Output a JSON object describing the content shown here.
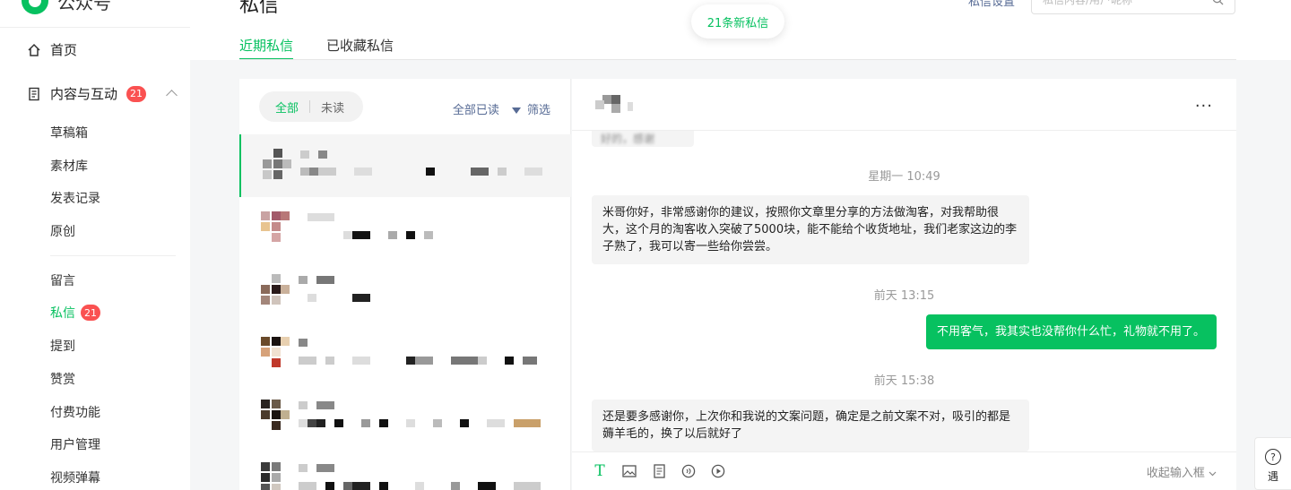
{
  "brand": {
    "name": "公众号"
  },
  "sidebar": {
    "home_label": "首页",
    "content_label": "内容与互动",
    "content_badge": "21",
    "group1": [
      "草稿箱",
      "素材库",
      "发表记录",
      "原创"
    ],
    "group2": [
      "留言",
      "私信",
      "提到",
      "赞赏",
      "付费功能",
      "用户管理",
      "视频弹幕"
    ],
    "messages_badge": "21"
  },
  "header": {
    "title": "私信",
    "settings": "私信设置",
    "search_placeholder": "私信内容/用户昵称",
    "toast": "21条新私信",
    "tabs": [
      "近期私信",
      "已收藏私信"
    ]
  },
  "list": {
    "filter_all": "全部",
    "filter_unread": "未读",
    "mark_all_read": "全部已读",
    "filter_label": "筛选"
  },
  "chat": {
    "truncated_text": "好的，感谢",
    "messages": [
      {
        "time": "星期一 10:49",
        "direction": "in",
        "text": "米哥你好，非常感谢你的建议，按照你文章里分享的方法做淘客，对我帮助很大，这个月的淘客收入突破了5000块，能不能给个收货地址，我们老家这边的李子熟了，我可以寄一些给你尝尝。"
      },
      {
        "time": "前天 13:15",
        "direction": "out",
        "text": "不用客气，我其实也没帮你什么忙，礼物就不用了。"
      },
      {
        "time": "前天 15:38",
        "direction": "in",
        "text": "还是要多感谢你，上次你和我说的文案问题，确定是之前文案不对，吸引的都是薅羊毛的，换了以后就好了"
      }
    ],
    "collapse_label": "收起输入框",
    "more": "···"
  },
  "help": {
    "label": "遇"
  },
  "colors": {
    "accent": "#07c160",
    "link": "#576b95",
    "badge": "#fa5151"
  }
}
